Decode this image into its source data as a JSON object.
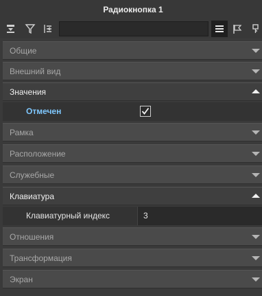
{
  "window": {
    "title": "Радиокнопка 1"
  },
  "toolbar": {
    "search_value": "",
    "colors": {
      "accent": "#7fc8ff",
      "panel": "#3b3b3b"
    }
  },
  "sections": {
    "general": {
      "label": "Общие",
      "expanded": false
    },
    "appearance": {
      "label": "Внешний вид",
      "expanded": false
    },
    "values": {
      "label": "Значения",
      "expanded": true
    },
    "frame": {
      "label": "Рамка",
      "expanded": false
    },
    "position": {
      "label": "Расположение",
      "expanded": false
    },
    "service": {
      "label": "Служебные",
      "expanded": false
    },
    "keyboard": {
      "label": "Клавиатура",
      "expanded": true
    },
    "relations": {
      "label": "Отношения",
      "expanded": false
    },
    "transform": {
      "label": "Трансформация",
      "expanded": false
    },
    "screen": {
      "label": "Экран",
      "expanded": false
    }
  },
  "properties": {
    "checked": {
      "label": "Отмечен",
      "value": true
    },
    "tab_index": {
      "label": "Клавиатурный индекс",
      "value": "3"
    }
  }
}
